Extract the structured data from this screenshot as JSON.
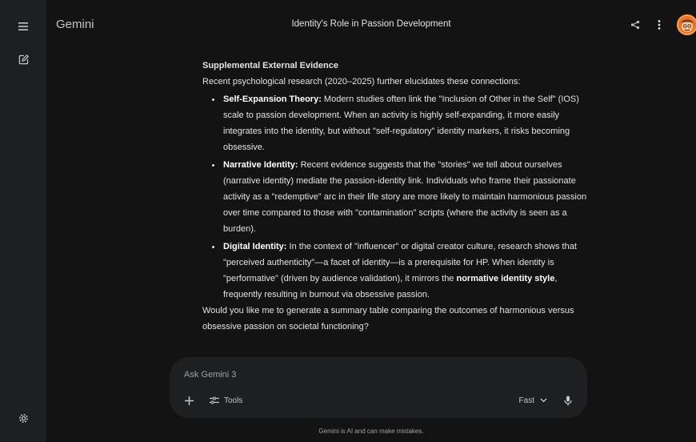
{
  "app": {
    "brand": "Gemini"
  },
  "header": {
    "title": "Identity's Role in Passion Development"
  },
  "sidebar": {
    "menu_icon": "hamburger-menu-icon",
    "new_chat_icon": "edit-square-icon",
    "settings_icon": "gear-icon"
  },
  "response": {
    "section_title": "Supplemental External Evidence",
    "intro": "Recent psychological research (2020–2025) further elucidates these connections:",
    "bullets": [
      {
        "term": "Self-Expansion Theory:",
        "text": " Modern studies often link the \"Inclusion of Other in the Self\" (IOS) scale to passion development. When an activity is highly self-expanding, it more easily integrates into the identity, but without \"self-regulatory\" identity markers, it risks becoming obsessive."
      },
      {
        "term": "Narrative Identity:",
        "text": " Recent evidence suggests that the \"stories\" we tell about ourselves (narrative identity) mediate the passion-identity link. Individuals who frame their passionate activity as a \"redemptive\" arc in their life story are more likely to maintain harmonious passion over time compared to those with \"contamination\" scripts (where the activity is seen as a burden)."
      },
      {
        "term": "Digital Identity:",
        "text": " In the context of \"influencer\" or digital creator culture, research shows that \"perceived authenticity\"—a facet of identity—is a prerequisite for HP. When identity is \"performative\" (driven by audience validation), it mirrors the ",
        "emphasis": "normative identity style",
        "tail": ", frequently resulting in burnout via obsessive passion."
      }
    ],
    "followup": "Would you like me to generate a summary table comparing the outcomes of harmonious versus obsessive passion on societal functioning?"
  },
  "composer": {
    "placeholder": "Ask Gemini 3",
    "value": "",
    "tools_label": "Tools",
    "mode_label": "Fast",
    "add_icon": "plus-icon",
    "tools_icon": "sliders-icon",
    "mode_icon": "chevron-down-icon",
    "mic_icon": "microphone-icon"
  },
  "footer": {
    "disclaimer": "Gemini is AI and can make mistakes."
  },
  "colors": {
    "background": "#131314",
    "surface": "#1e1f20",
    "text": "#e3e3e3",
    "muted": "#a0a3a2",
    "avatar": "#e8722e"
  }
}
